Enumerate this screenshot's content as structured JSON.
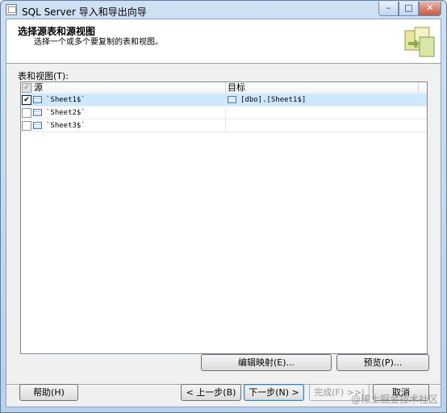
{
  "window": {
    "title": "SQL Server 导入和导出向导",
    "min": "–",
    "max": "□",
    "close": "✕"
  },
  "header": {
    "title": "选择源表和源视图",
    "subtitle": "选择一个或多个要复制的表和视图。"
  },
  "table": {
    "label": "表和视图(T):",
    "columns": {
      "source": "源",
      "destination": "目标"
    },
    "rows": [
      {
        "checked": true,
        "source": "`Sheet1$`",
        "destination": "[dbo].[Sheet1$]"
      },
      {
        "checked": false,
        "source": "`Sheet2$`",
        "destination": ""
      },
      {
        "checked": false,
        "source": "`Sheet3$`",
        "destination": ""
      }
    ]
  },
  "buttons": {
    "edit_mappings": "编辑映射(E)...",
    "preview": "预览(P)...",
    "help": "帮助(H)",
    "back": "< 上一步(B)",
    "next": "下一步(N) >",
    "finish": "完成(F) >>|",
    "cancel": "取消"
  },
  "watermark": "@稀土掘金技术社区",
  "check_mark": "✔",
  "header_check": "✓"
}
